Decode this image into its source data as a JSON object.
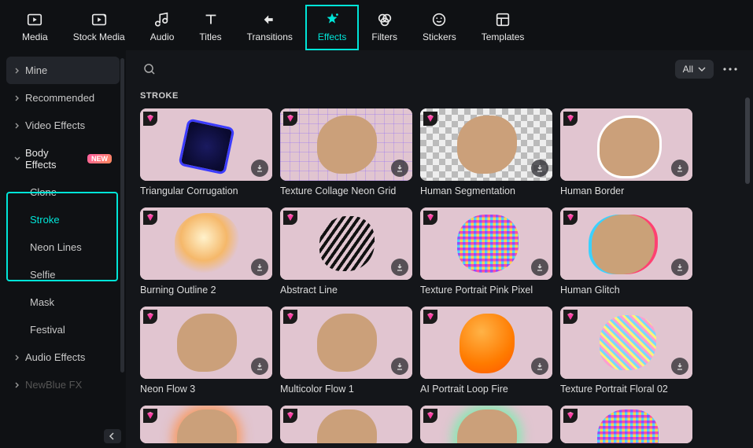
{
  "topnav": {
    "items": [
      {
        "label": "Media",
        "icon": "media-icon"
      },
      {
        "label": "Stock Media",
        "icon": "stock-media-icon"
      },
      {
        "label": "Audio",
        "icon": "audio-icon"
      },
      {
        "label": "Titles",
        "icon": "titles-icon"
      },
      {
        "label": "Transitions",
        "icon": "transitions-icon"
      },
      {
        "label": "Effects",
        "icon": "effects-icon"
      },
      {
        "label": "Filters",
        "icon": "filters-icon"
      },
      {
        "label": "Stickers",
        "icon": "stickers-icon"
      },
      {
        "label": "Templates",
        "icon": "templates-icon"
      }
    ],
    "active_index": 5
  },
  "sidebar": {
    "items": [
      {
        "label": "Mine",
        "type": "group"
      },
      {
        "label": "Recommended",
        "type": "group"
      },
      {
        "label": "Video Effects",
        "type": "group"
      },
      {
        "label": "Body Effects",
        "type": "group",
        "expanded": true,
        "badge": "NEW"
      },
      {
        "label": "Clone",
        "type": "sub"
      },
      {
        "label": "Stroke",
        "type": "sub",
        "selected": true
      },
      {
        "label": "Neon Lines",
        "type": "sub"
      },
      {
        "label": "Selfie",
        "type": "sub"
      },
      {
        "label": "Mask",
        "type": "sub"
      },
      {
        "label": "Festival",
        "type": "sub"
      },
      {
        "label": "Audio Effects",
        "type": "group"
      },
      {
        "label": "NewBlue FX",
        "type": "group",
        "faded": true
      }
    ]
  },
  "content": {
    "filter_label": "All",
    "section_title": "STROKE",
    "cards": [
      {
        "label": "Triangular Corrugation",
        "art": "triang",
        "premium": true
      },
      {
        "label": "Texture Collage Neon Grid",
        "art": "neongrid",
        "premium": true
      },
      {
        "label": "Human Segmentation",
        "art": "seg",
        "premium": true,
        "checker": true
      },
      {
        "label": "Human Border",
        "art": "border",
        "premium": true
      },
      {
        "label": "Burning Outline 2",
        "art": "glow",
        "premium": true
      },
      {
        "label": "Abstract Line",
        "art": "stripes",
        "premium": true
      },
      {
        "label": "Texture Portrait Pink Pixel",
        "art": "pixel",
        "premium": true
      },
      {
        "label": "Human Glitch",
        "art": "glitch",
        "premium": true
      },
      {
        "label": "Neon Flow 3",
        "art": "plain",
        "premium": true
      },
      {
        "label": "Multicolor Flow 1",
        "art": "plain",
        "premium": true
      },
      {
        "label": "AI Portrait Loop Fire",
        "art": "fire",
        "premium": true
      },
      {
        "label": "Texture Portrait Floral 02",
        "art": "floral",
        "premium": true
      },
      {
        "label": "",
        "art": "orangeglow",
        "premium": true,
        "partial": true
      },
      {
        "label": "",
        "art": "plain",
        "premium": true,
        "partial": true
      },
      {
        "label": "",
        "art": "greenglow",
        "premium": true,
        "partial": true
      },
      {
        "label": "",
        "art": "pixel",
        "premium": true,
        "partial": true
      }
    ]
  },
  "colors": {
    "accent": "#00e5d8",
    "gem": "#ff3fa4"
  }
}
